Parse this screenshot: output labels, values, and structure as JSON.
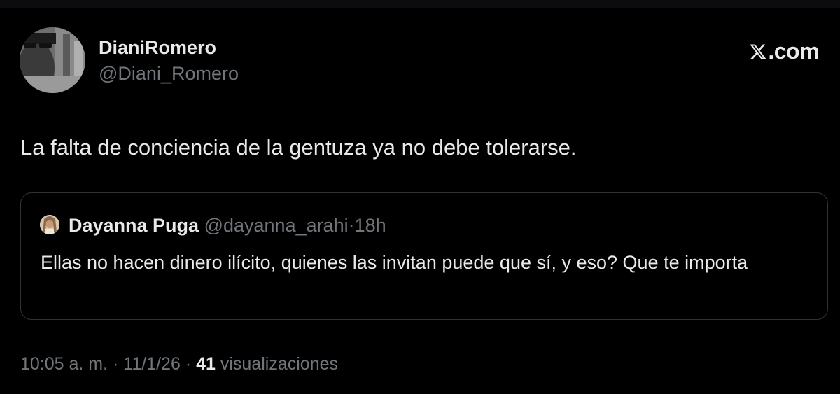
{
  "tweet": {
    "author_name": "DianiRomero",
    "author_handle": "@Diani_Romero",
    "text": "La falta de conciencia de la gentuza ya no debe tolerarse.",
    "time": "10:05 a. m.",
    "date": "11/1/26",
    "separator": "·",
    "views_count": "41",
    "views_label": "visualizaciones"
  },
  "brand": {
    "logo_icon": "x-logo-icon",
    "domain_suffix": ".com"
  },
  "quote": {
    "author_name": "Dayanna Puga",
    "author_handle": "@dayanna_arahi",
    "separator": "·",
    "time_ago": "18h",
    "text": "Ellas no hacen dinero ilícito, quienes las invitan puede que sí, y eso? Que te importa"
  },
  "colors": {
    "background": "#000000",
    "primary_text": "#e7e9ea",
    "secondary_text": "#71767b",
    "border": "#2f3336"
  }
}
